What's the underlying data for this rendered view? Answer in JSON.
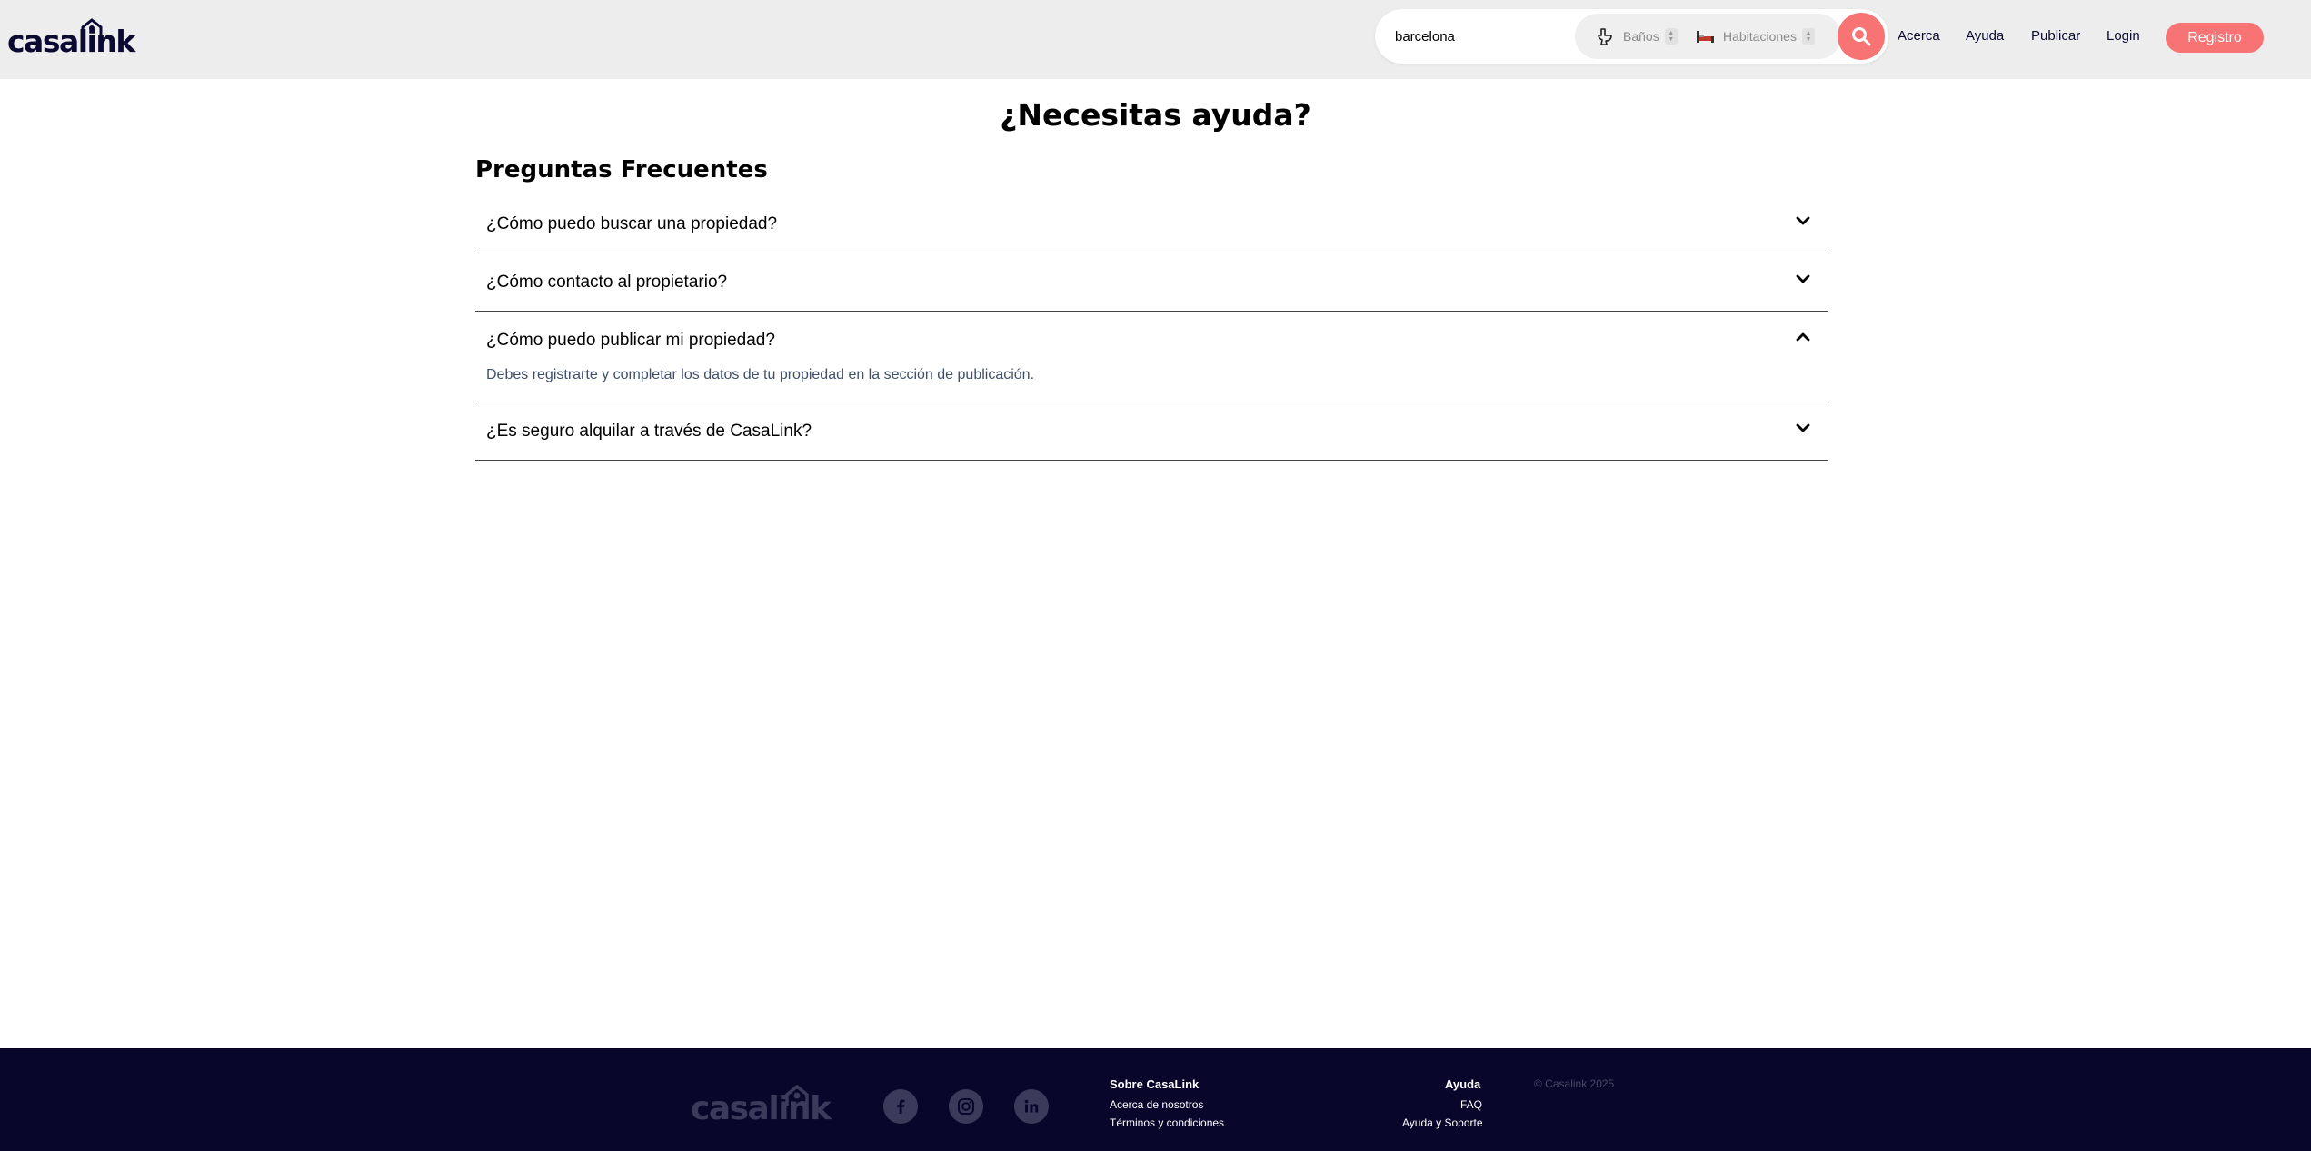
{
  "header": {
    "logo_text": "casalink",
    "search_value": "barcelona",
    "filters": {
      "baths_label": "Baños",
      "rooms_label": "Habitaciones"
    },
    "nav": {
      "acerca": "Acerca",
      "ayuda": "Ayuda",
      "publicar": "Publicar",
      "login": "Login"
    },
    "register_label": "Registro"
  },
  "main": {
    "title": "¿Necesitas ayuda?",
    "faq_title": "Preguntas Frecuentes",
    "faq": [
      {
        "question": "¿Cómo puedo buscar una propiedad?",
        "open": false
      },
      {
        "question": "¿Cómo contacto al propietario?",
        "open": false
      },
      {
        "question": "¿Cómo puedo publicar mi propiedad?",
        "open": true,
        "answer": "Debes registrarte y completar los datos de tu propiedad en la sección de publicación."
      },
      {
        "question": "¿Es seguro alquilar a través de CasaLink?",
        "open": false
      }
    ]
  },
  "footer": {
    "logo_text": "casalink",
    "social": [
      "facebook-icon",
      "instagram-icon",
      "linkedin-icon"
    ],
    "about": {
      "title": "Sobre CasaLink",
      "links": [
        "Acerca de nosotros",
        "Términos y condiciones"
      ]
    },
    "help": {
      "title": "Ayuda",
      "links": [
        "FAQ",
        "Ayuda y Soporte"
      ]
    },
    "copyright": "© Casalink 2025"
  },
  "colors": {
    "accent": "#f87373",
    "navy": "#0b0a33",
    "footer_bg": "#08062b",
    "header_bg": "#ededed"
  }
}
